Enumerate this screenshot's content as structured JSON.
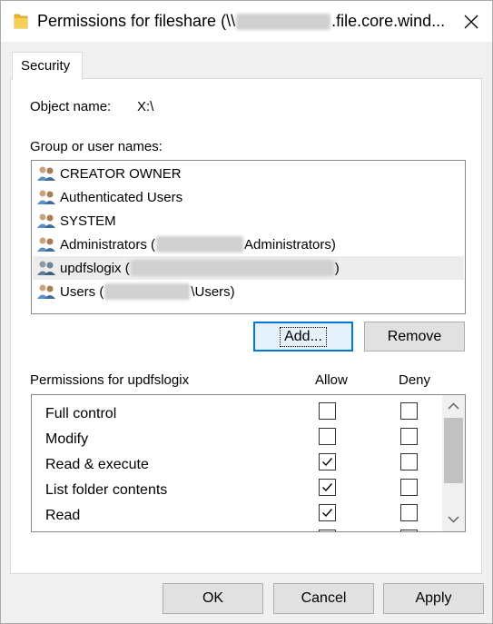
{
  "window": {
    "title_prefix": "Permissions for fileshare (\\\\",
    "title_suffix": ".file.core.wind...",
    "close_glyph": "✕"
  },
  "tabs": [
    {
      "label": "Security"
    }
  ],
  "object": {
    "label": "Object name:",
    "value": "X:\\"
  },
  "group_label": "Group or user names:",
  "users": [
    {
      "pre": "CREATOR OWNER",
      "post": ""
    },
    {
      "pre": "Authenticated Users",
      "post": ""
    },
    {
      "pre": "SYSTEM",
      "post": ""
    },
    {
      "pre": "Administrators (",
      "post": "Administrators)"
    },
    {
      "pre": "updfslogix (",
      "post": ")",
      "selected": true
    },
    {
      "pre": "Users (",
      "post": "\\Users)"
    }
  ],
  "buttons": {
    "add": "Add...",
    "remove": "Remove",
    "ok": "OK",
    "cancel": "Cancel",
    "apply": "Apply"
  },
  "permissions": {
    "header": "Permissions for updfslogix",
    "allow": "Allow",
    "deny": "Deny",
    "rows": [
      {
        "name": "Full control",
        "allow": false,
        "deny": false
      },
      {
        "name": "Modify",
        "allow": false,
        "deny": false
      },
      {
        "name": "Read & execute",
        "allow": true,
        "deny": false
      },
      {
        "name": "List folder contents",
        "allow": true,
        "deny": false
      },
      {
        "name": "Read",
        "allow": true,
        "deny": false
      },
      {
        "name": "",
        "allow": false,
        "deny": false
      }
    ]
  },
  "colors": {
    "focus": "#0078d7",
    "accent_folder": "#e8b830",
    "selected_row": "#ececec"
  }
}
